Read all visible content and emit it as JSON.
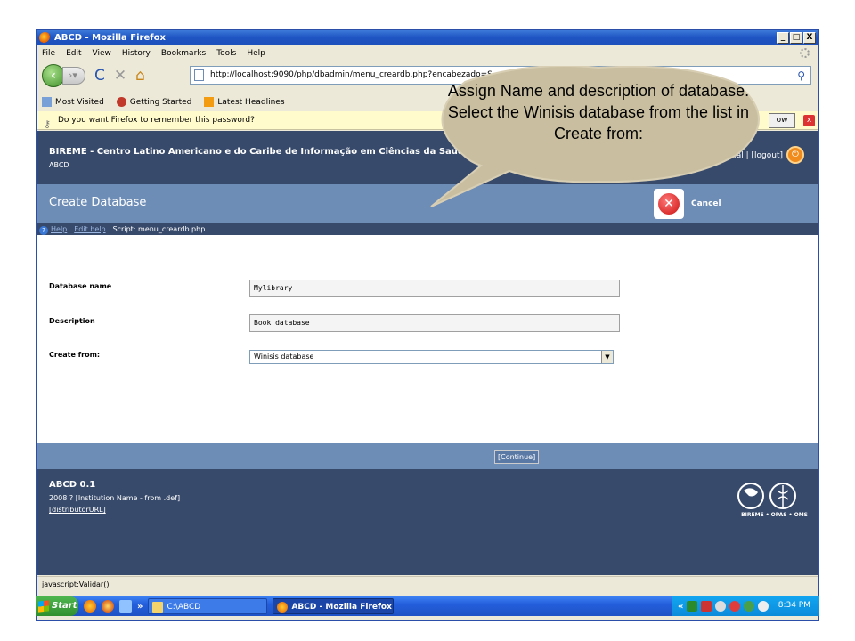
{
  "window": {
    "title": "ABCD - Mozilla Firefox",
    "controls": [
      "_",
      "□",
      "X"
    ]
  },
  "menubar": [
    "File",
    "Edit",
    "View",
    "History",
    "Bookmarks",
    "Tools",
    "Help"
  ],
  "navbar": {
    "url": "http://localhost:9090/php/dbadmin/menu_creardb.php?encabezado=S"
  },
  "bookmarks": [
    "Most Visited",
    "Getting Started",
    "Latest Headlines"
  ],
  "password_bar": {
    "message": "Do you want Firefox to remember this password?",
    "button_fragment": "ow"
  },
  "site_header": {
    "org_name": "BIREME - Centro Latino Americano e do Caribe de Informação em Ciências da Saúde",
    "org_sub": "ABCD",
    "links": "…al | [logout]"
  },
  "section": {
    "title": "Create Database",
    "cancel_label": "Cancel"
  },
  "help_bar": {
    "help": "Help",
    "edit_help": "Edit help",
    "script": "Script: menu_creardb.php"
  },
  "form": {
    "db_name_label": "Database name",
    "db_name_value": "Mylibrary",
    "description_label": "Description",
    "description_value": "Book database",
    "create_from_label": "Create from:",
    "create_from_value": "Winisis database"
  },
  "action_bar": {
    "continue_label": "[Continue]"
  },
  "site_footer": {
    "version": "ABCD 0.1",
    "copyright": "2008 ? [Institution Name - from .def]",
    "distributor": "[distributorURL]",
    "logo_text": "BIREME • OPAS • OMS"
  },
  "statusbar": {
    "text": "javascript:Validar()"
  },
  "taskbar": {
    "start": "Start",
    "chevron": "»",
    "folder_task": "C:\\ABCD",
    "firefox_task": "ABCD - Mozilla Firefox",
    "tray_chevron": "«",
    "clock": "8:34 PM"
  },
  "callout": {
    "text": "Assign Name and description of database. Select the Winisis database from the list in Create from:"
  },
  "colors": {
    "header_dark": "#374a6b",
    "section_blue": "#6d8db7",
    "callout_fill": "#c9bfa0",
    "titlebar_blue": "#1f55c4"
  }
}
